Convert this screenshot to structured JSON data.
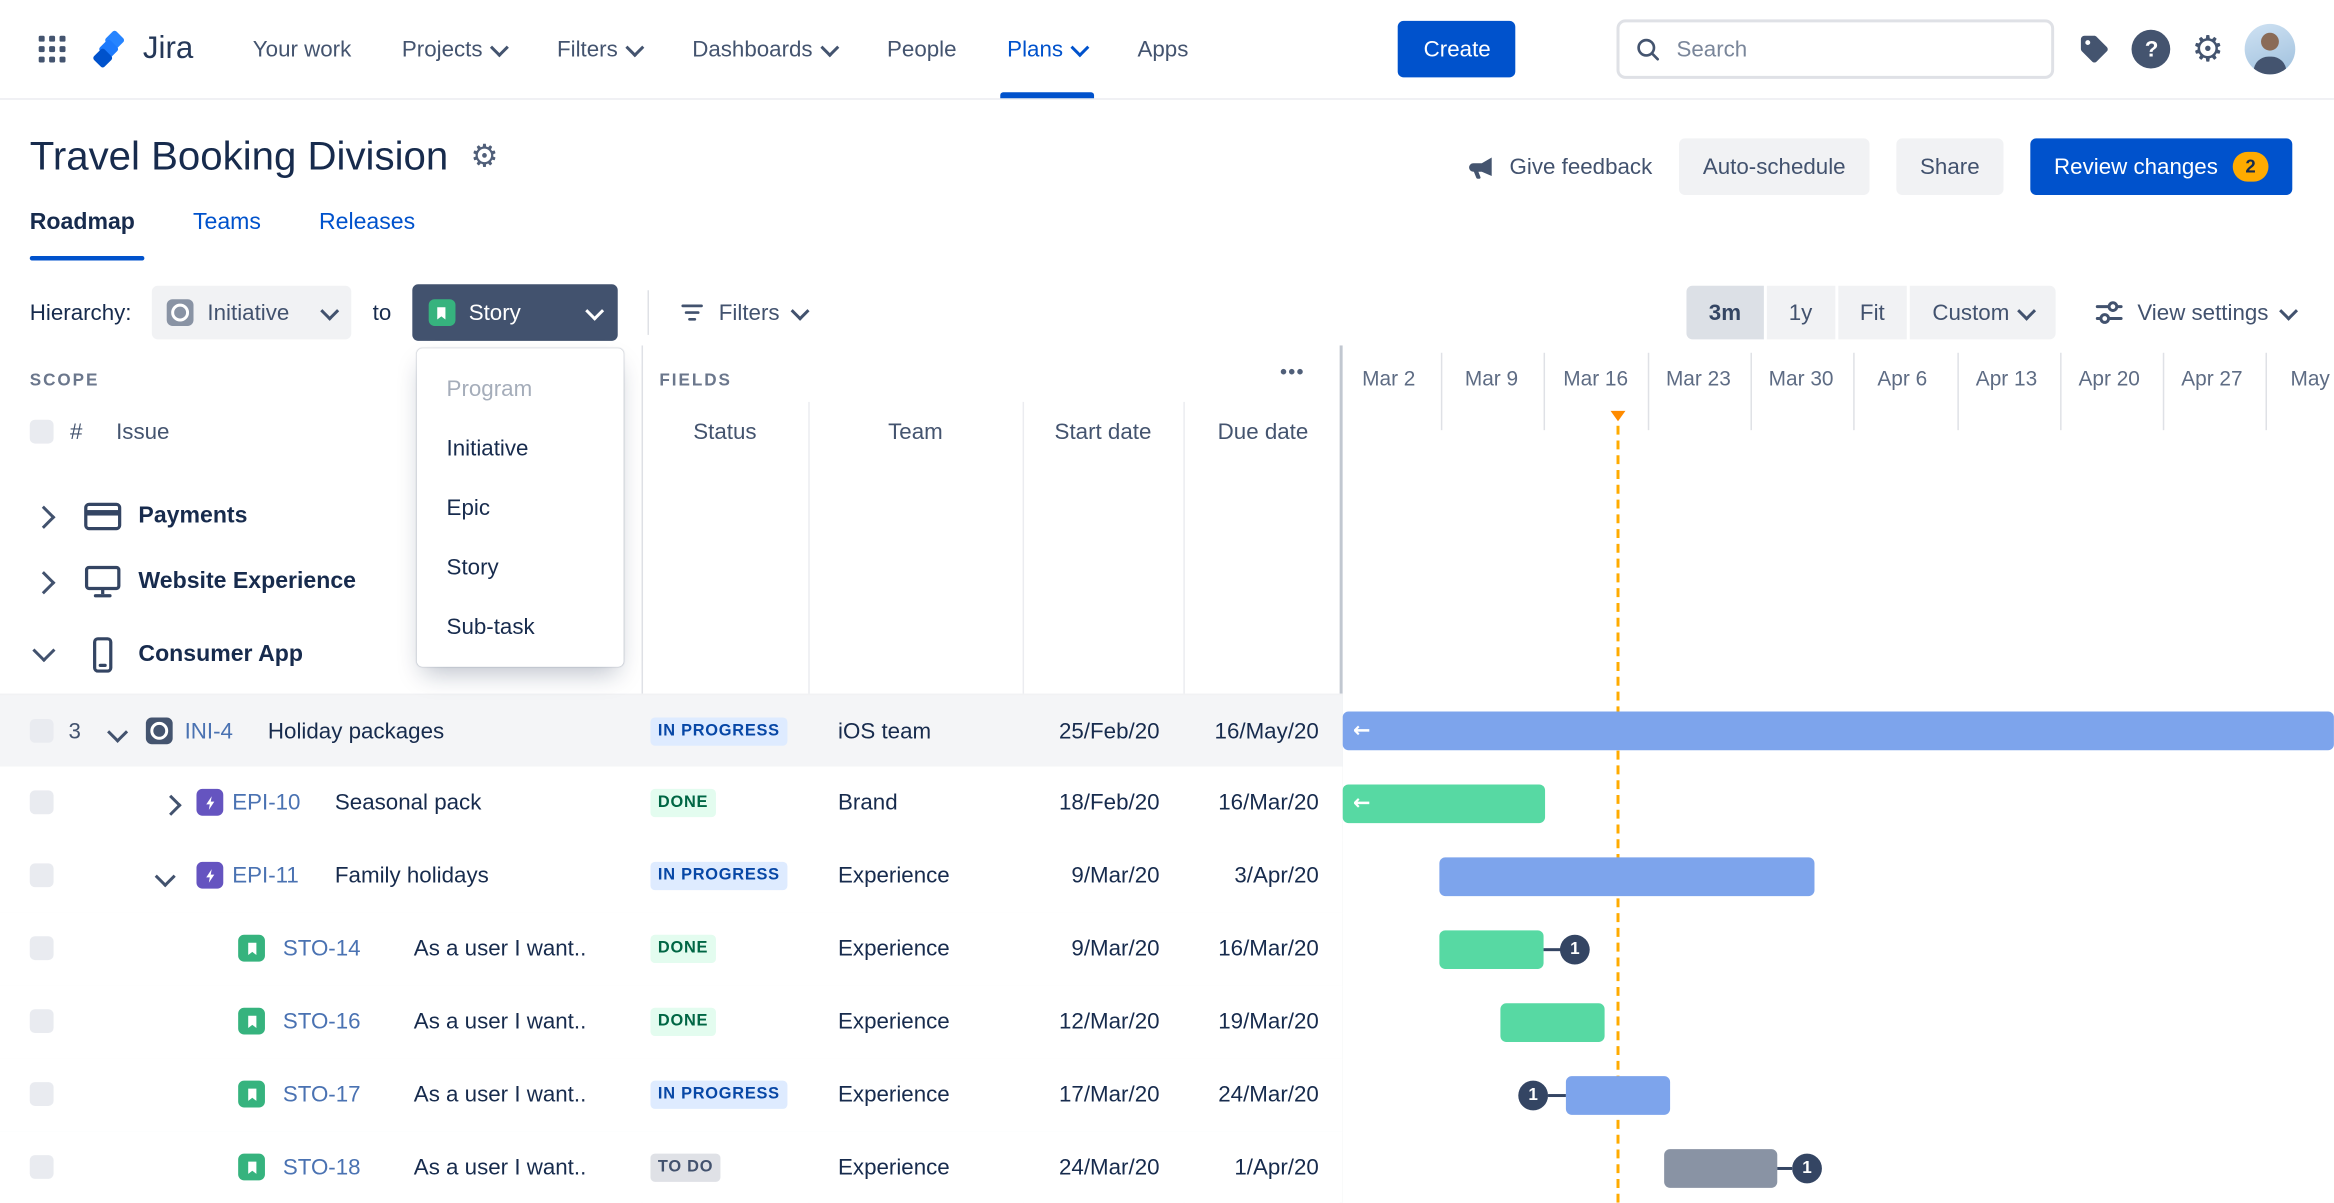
{
  "nav": {
    "brand": "Jira",
    "items": [
      {
        "label": "Your work"
      },
      {
        "label": "Projects"
      },
      {
        "label": "Filters"
      },
      {
        "label": "Dashboards"
      },
      {
        "label": "People"
      },
      {
        "label": "Plans",
        "active": true
      },
      {
        "label": "Apps"
      }
    ],
    "create_label": "Create",
    "search_placeholder": "Search"
  },
  "header": {
    "title": "Travel Booking Division",
    "give_feedback": "Give feedback",
    "auto_schedule": "Auto-schedule",
    "share": "Share",
    "review_changes": "Review changes",
    "review_badge": "2"
  },
  "tabs": {
    "roadmap": "Roadmap",
    "teams": "Teams",
    "releases": "Releases"
  },
  "toolbar": {
    "hierarchy_label": "Hierarchy:",
    "from_level": "Initiative",
    "to_word": "to",
    "to_level": "Story",
    "filters_label": "Filters",
    "zoom_options": [
      "3m",
      "1y",
      "Fit",
      "Custom"
    ],
    "selected_zoom": "3m",
    "view_settings_label": "View settings"
  },
  "level_menu": [
    "Program",
    "Initiative",
    "Epic",
    "Story",
    "Sub-task"
  ],
  "scope": {
    "section_label": "SCOPE",
    "hash_header": "#",
    "issue_header": "Issue",
    "groups": [
      "Payments",
      "Website Experience",
      "Consumer App"
    ]
  },
  "fields": {
    "section_label": "FIELDS",
    "more_label": "•••",
    "columns": [
      "Status",
      "Team",
      "Start date",
      "Due date"
    ]
  },
  "timeline": {
    "labels": [
      "Mar 2",
      "Mar 9",
      "Mar 16",
      "Mar 23",
      "Mar 30",
      "Apr 6",
      "Apr 13",
      "Apr 20",
      "Apr 27",
      "May"
    ]
  },
  "rows": [
    {
      "count": "3",
      "key": "INI-4",
      "summary": "Holiday packages",
      "status": "IN PROGRESS",
      "team": "iOS team",
      "start": "25/Feb/20",
      "due": "16/May/20"
    },
    {
      "key": "EPI-10",
      "summary": "Seasonal pack",
      "status": "DONE",
      "team": "Brand",
      "start": "18/Feb/20",
      "due": "16/Mar/20"
    },
    {
      "key": "EPI-11",
      "summary": "Family holidays",
      "status": "IN PROGRESS",
      "team": "Experience",
      "start": "9/Mar/20",
      "due": "3/Apr/20"
    },
    {
      "key": "STO-14",
      "summary": "As a user I want..",
      "status": "DONE",
      "team": "Experience",
      "start": "9/Mar/20",
      "due": "16/Mar/20",
      "badge": "1"
    },
    {
      "key": "STO-16",
      "summary": "As a user I want..",
      "status": "DONE",
      "team": "Experience",
      "start": "12/Mar/20",
      "due": "19/Mar/20"
    },
    {
      "key": "STO-17",
      "summary": "As a user I want..",
      "status": "IN PROGRESS",
      "team": "Experience",
      "start": "17/Mar/20",
      "due": "24/Mar/20",
      "badge": "1"
    },
    {
      "key": "STO-18",
      "summary": "As a user I want..",
      "status": "TO DO",
      "team": "Experience",
      "start": "24/Mar/20",
      "due": "1/Apr/20",
      "badge": "1"
    }
  ],
  "icons": {
    "gear": "⚙",
    "question": "?",
    "more": "•••",
    "arrow_left": "←"
  },
  "colors": {
    "brand_blue": "#0052CC",
    "badge_orange": "#FFAB00",
    "bar_blue": "#7DA4EC",
    "bar_green": "#57D9A3",
    "bar_gray": "#8993A4",
    "today_orange": "#FFAB00"
  }
}
